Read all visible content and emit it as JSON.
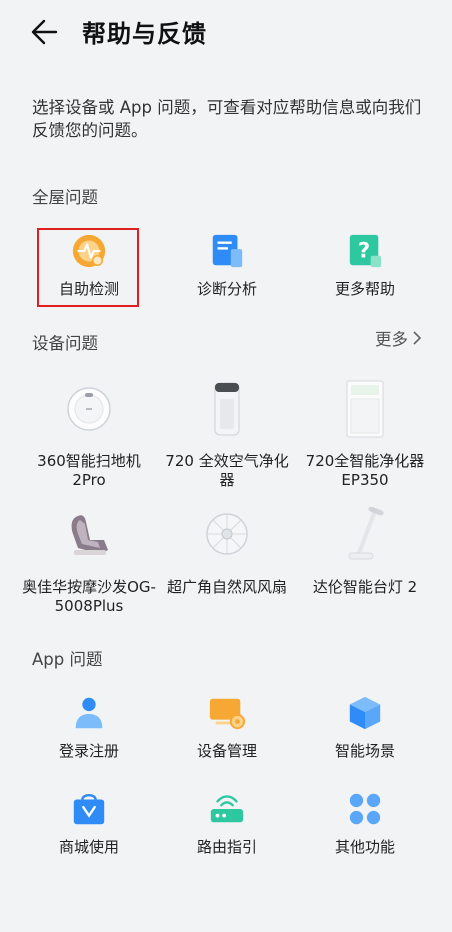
{
  "header": {
    "title": "帮助与反馈"
  },
  "intro": "选择设备或 App 问题，可查看对应帮助信息或向我们反馈您的问题。",
  "whole_house": {
    "label": "全屋问题",
    "items": [
      {
        "label": "自助检测",
        "icon": "self-check-icon"
      },
      {
        "label": "诊断分析",
        "icon": "diagnosis-icon"
      },
      {
        "label": "更多帮助",
        "icon": "more-help-icon"
      }
    ]
  },
  "device": {
    "label": "设备问题",
    "more": "更多",
    "items": [
      {
        "label": "360智能扫地机2Pro",
        "icon": "robot-vacuum-icon"
      },
      {
        "label": "720 全效空气净化器",
        "icon": "air-purifier-icon"
      },
      {
        "label": "720全智能净化器EP350",
        "icon": "purifier-ep350-icon"
      },
      {
        "label": "奥佳华按摩沙发OG-5008Plus",
        "icon": "massage-chair-icon"
      },
      {
        "label": "超广角自然风风扇",
        "icon": "fan-icon"
      },
      {
        "label": "达伦智能台灯 2",
        "icon": "desk-lamp-icon"
      }
    ]
  },
  "app": {
    "label": "App 问题",
    "items": [
      {
        "label": "登录注册",
        "icon": "login-user-icon"
      },
      {
        "label": "设备管理",
        "icon": "device-manage-icon"
      },
      {
        "label": "智能场景",
        "icon": "smart-scene-icon"
      },
      {
        "label": "商城使用",
        "icon": "shopping-bag-icon"
      },
      {
        "label": "路由指引",
        "icon": "router-icon"
      },
      {
        "label": "其他功能",
        "icon": "other-functions-icon"
      }
    ]
  },
  "colors": {
    "accent_blue": "#2f8bf5",
    "accent_teal": "#2ec8a0",
    "accent_orange": "#f7a733",
    "highlight": "#e02020"
  }
}
